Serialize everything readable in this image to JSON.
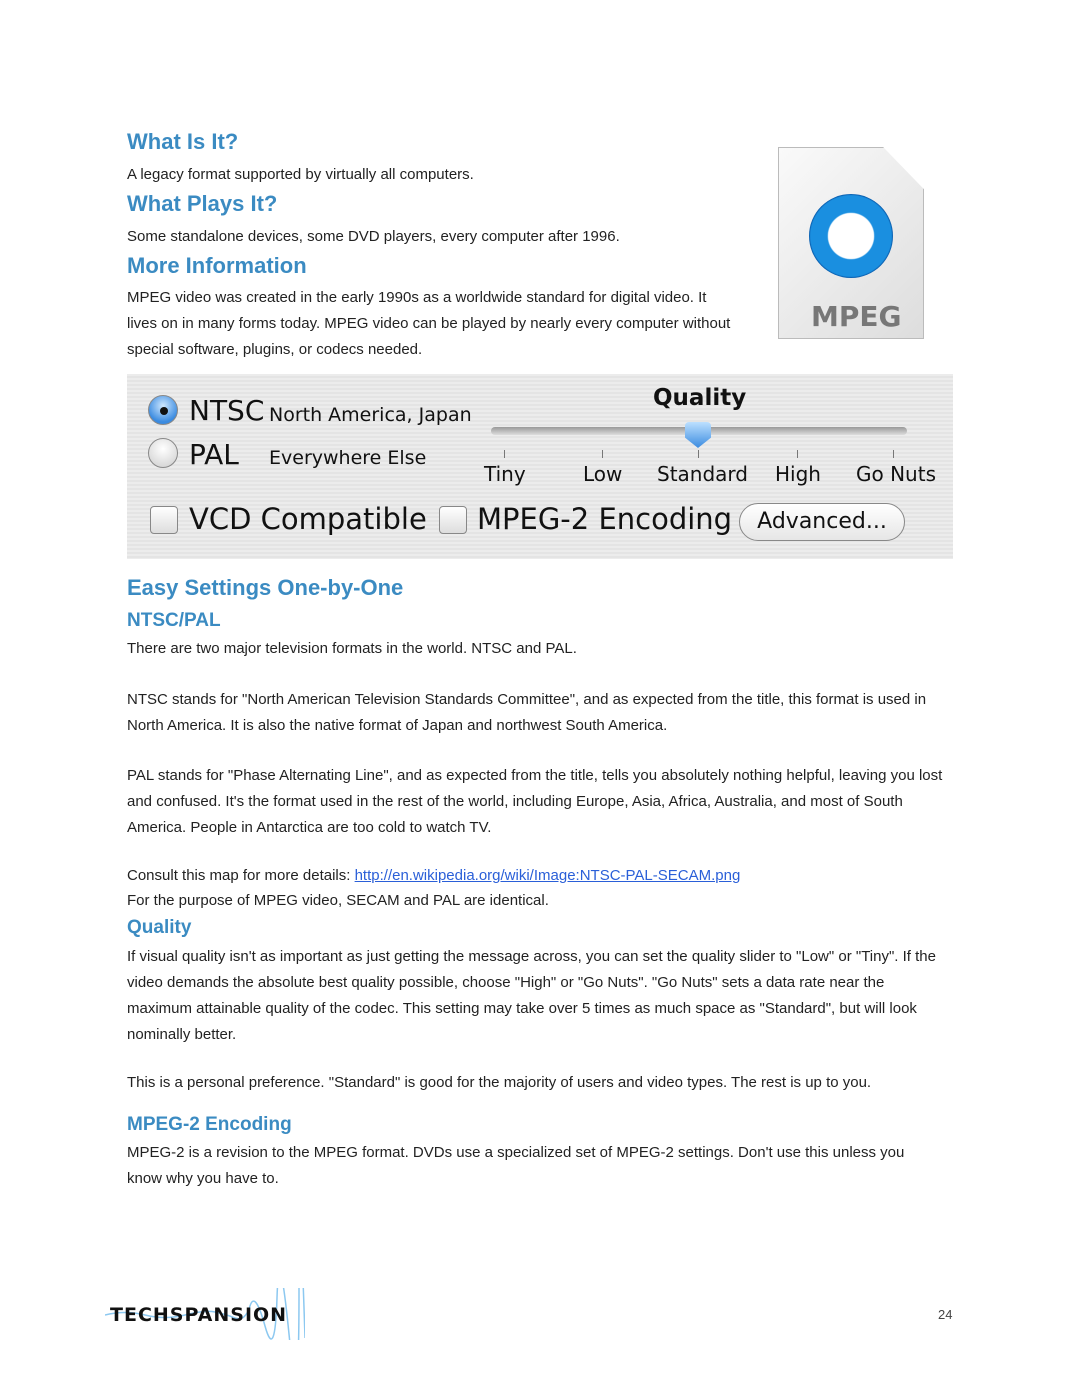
{
  "sections": {
    "what_is_it": {
      "title": "What Is It?",
      "body": "A legacy format supported by virtually all computers."
    },
    "what_plays_it": {
      "title": "What Plays It?",
      "body": "Some standalone devices, some DVD players, every computer after 1996."
    },
    "more_info": {
      "title": "More Information",
      "body": "MPEG video was created in the early 1990s as a worldwide standard for digital video. It lives on in many forms today. MPEG video can be played by nearly every computer without special software, plugins, or codecs needed."
    }
  },
  "file_icon": {
    "label": "MPEG",
    "icon": "quicktime-mpeg-file-icon"
  },
  "panel": {
    "ntsc": {
      "label": "NTSC",
      "desc": "North America, Japan",
      "selected": true
    },
    "pal": {
      "label": "PAL",
      "desc": "Everywhere Else",
      "selected": false
    },
    "quality_title": "Quality",
    "quality_levels": [
      "Tiny",
      "Low",
      "Standard",
      "High",
      "Go Nuts"
    ],
    "quality_selected": "Standard",
    "vcd": {
      "label": "VCD Compatible",
      "checked": false
    },
    "mpeg2": {
      "label": "MPEG-2 Encoding",
      "checked": false
    },
    "advanced": "Advanced..."
  },
  "easy": {
    "title": "Easy Settings One-by-One",
    "ntsc_pal_title": "NTSC/PAL",
    "p1": "There are two major television formats in the world. NTSC and PAL.",
    "p2": "NTSC stands for \"North American Television Standards Committee\", and as expected from the title, this format is used in North America. It is also the native format of Japan and northwest South America.",
    "p3": "PAL stands for \"Phase Alternating Line\", and as expected from the title, tells you absolutely nothing helpful, leaving you lost and confused. It's the format used in the rest of the world, including Europe, Asia,  Africa, Australia, and most of South America. People in Antarctica are too cold to watch TV.",
    "p4_prefix": "Consult this map for more details: ",
    "p4_link": "http://en.wikipedia.org/wiki/Image:NTSC-PAL-SECAM.png",
    "p5": "For the purpose of MPEG video, SECAM and PAL are identical.",
    "quality_title": "Quality",
    "q1": "If visual quality isn't as important as just getting the message across, you can set the quality slider to \"Low\" or \"Tiny\". If the video demands the absolute best quality possible, choose \"High\" or \"Go Nuts\". \"Go Nuts\" sets a data rate near the maximum attainable quality of the codec. This setting may take over 5 times as much space as \"Standard\", but will look nominally better.",
    "q2": "This is a personal preference. \"Standard\" is good for the majority of users and video types. The rest is up to you.",
    "mpeg2_title": "MPEG-2 Encoding",
    "m1": "MPEG-2 is a revision to the MPEG format. DVDs use a specialized set of MPEG-2 settings. Don't use this unless you know why you have to."
  },
  "footer": {
    "logo": "TECHSPANSION",
    "page": "24"
  },
  "colors": {
    "heading": "#3b8bc2",
    "link": "#2a5fd8"
  }
}
